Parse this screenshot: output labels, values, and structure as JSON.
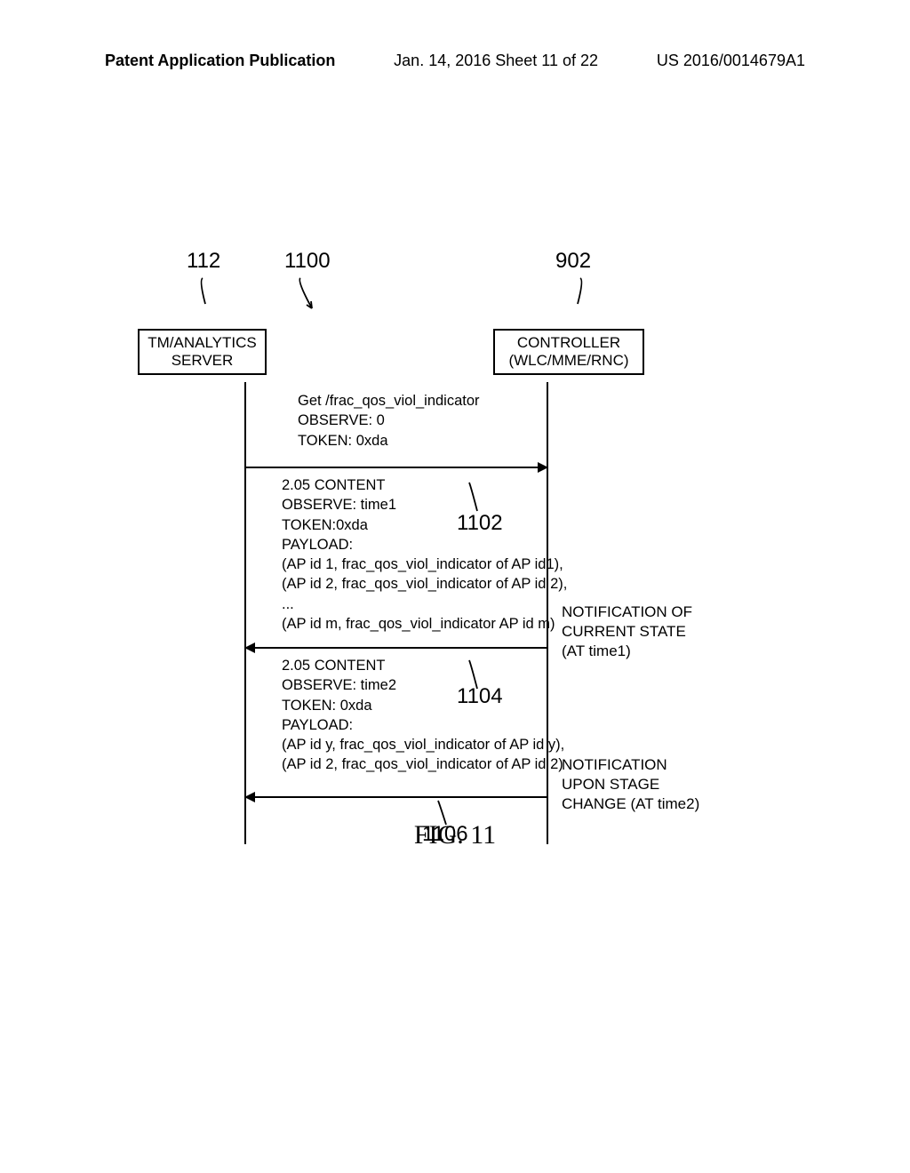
{
  "header": {
    "left": "Patent Application Publication",
    "center": "Jan. 14, 2016  Sheet 11 of 22",
    "right": "US 2016/0014679A1"
  },
  "labels": {
    "l112": "112",
    "l1100": "1100",
    "l902": "902"
  },
  "boxes": {
    "left_line1": "TM/ANALYTICS",
    "left_line2": "SERVER",
    "right_line1": "CONTROLLER",
    "right_line2": "(WLC/MME/RNC)"
  },
  "msg1": {
    "l1": "Get /frac_qos_viol_indicator",
    "l2": "OBSERVE: 0",
    "l3": "TOKEN: 0xda"
  },
  "msg2": {
    "l1": "2.05 CONTENT",
    "l2": "OBSERVE: time1",
    "l3": "TOKEN:0xda",
    "l4": "PAYLOAD:",
    "l5": "(AP id 1, frac_qos_viol_indicator of AP id1),",
    "l6": "(AP id 2, frac_qos_viol_indicator of AP id 2),",
    "l7": "...",
    "l8": "(AP id m, frac_qos_viol_indicator AP id m)"
  },
  "msg3": {
    "l1": "2.05 CONTENT",
    "l2": "OBSERVE: time2",
    "l3": "TOKEN: 0xda",
    "l4": "PAYLOAD:",
    "l5": "(AP id y, frac_qos_viol_indicator of AP id y),",
    "l6": "(AP id 2, frac_qos_viol_indicator of AP id 2)"
  },
  "refs": {
    "r1102": "1102",
    "r1104": "1104",
    "r1106": "1106"
  },
  "side_notes": {
    "note1_l1": "NOTIFICATION OF",
    "note1_l2": "CURRENT STATE",
    "note1_l3": "(AT time1)",
    "note2_l1": "NOTIFICATION",
    "note2_l2": "UPON STAGE",
    "note2_l3": "CHANGE (AT time2)"
  },
  "caption": "FIG. 11"
}
